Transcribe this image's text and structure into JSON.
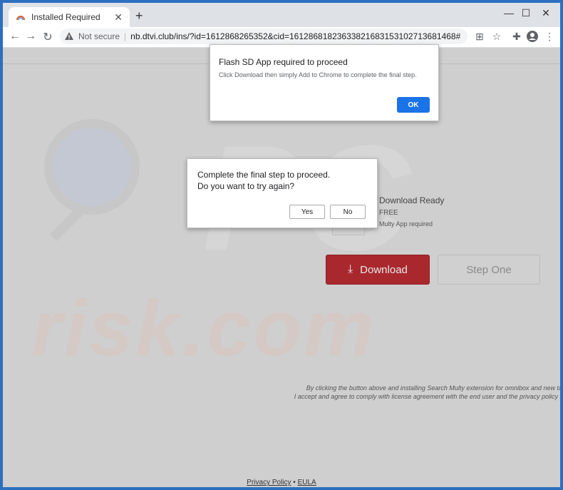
{
  "browser": {
    "tab_title": "Installed Required",
    "tab_close": "✕",
    "new_tab": "+",
    "minimize": "—",
    "maximize": "☐",
    "close": "✕",
    "back": "←",
    "forward": "→",
    "reload": "↻",
    "not_secure": "Not secure",
    "url": "nb.dtvi.club/ins/?id=1612868265352&cid=16128681823633821683153102713681468#"
  },
  "page": {
    "download_ready": "Download Ready",
    "free": "FREE",
    "multy_required": "Multy App required",
    "download_button": "Download",
    "download_arrow": "⤓",
    "step_one_button": "Step One",
    "disclaimer_line1": "By clicking the button above and installing Search Multy extension for omnibox and new tab",
    "disclaimer_line2": "I accept and agree to comply with license agreement with the end user and the privacy policy lis",
    "privacy_policy": "Privacy Policy",
    "bullet": " • ",
    "eula": "EULA",
    "watermark": "risk.com"
  },
  "alert_top": {
    "title": "Flash SD App required to proceed",
    "message": "Click Download then simply Add to Chrome to complete the final step.",
    "ok_label": "OK"
  },
  "alert_confirm": {
    "line1": "Complete the final step to proceed.",
    "line2": "Do you want to try again?",
    "yes_label": "Yes",
    "no_label": "No"
  }
}
